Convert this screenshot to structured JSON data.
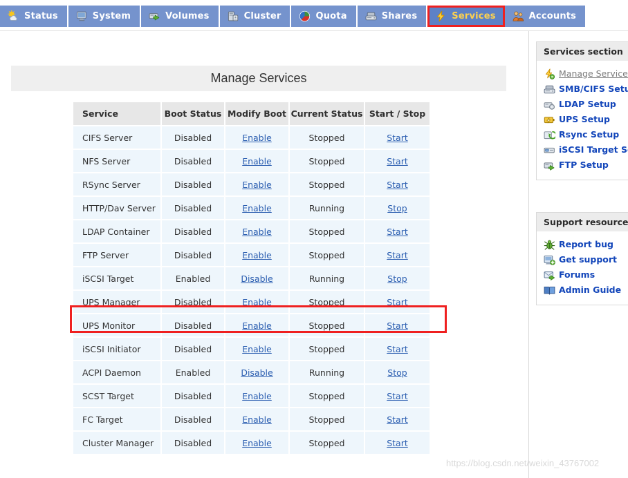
{
  "nav": {
    "tabs": [
      {
        "label": "Status",
        "icon": "sun-cloud-icon",
        "active": false
      },
      {
        "label": "System",
        "icon": "monitor-icon",
        "active": false
      },
      {
        "label": "Volumes",
        "icon": "disk-arrow-icon",
        "active": false
      },
      {
        "label": "Cluster",
        "icon": "servers-icon",
        "active": false
      },
      {
        "label": "Quota",
        "icon": "pie-chart-icon",
        "active": false
      },
      {
        "label": "Shares",
        "icon": "drive-icon",
        "active": false
      },
      {
        "label": "Services",
        "icon": "lightning-icon",
        "active": true
      },
      {
        "label": "Accounts",
        "icon": "people-icon",
        "active": false
      }
    ],
    "active_tab": "Services",
    "active_highlight_color": "#ef2020",
    "tab_bg": "#7593cd",
    "tab_active_bg": "#5d81c6",
    "tab_active_text_color": "#ffd24d"
  },
  "main": {
    "title": "Manage Services",
    "table": {
      "columns": [
        "Service",
        "Boot Status",
        "Modify Boot",
        "Current Status",
        "Start / Stop"
      ],
      "rows": [
        {
          "service": "CIFS Server",
          "boot_status": "Disabled",
          "modify_boot": "Enable",
          "current_status": "Stopped",
          "start_stop": "Start",
          "boot_on": false,
          "running": false,
          "highlighted": false
        },
        {
          "service": "NFS Server",
          "boot_status": "Disabled",
          "modify_boot": "Enable",
          "current_status": "Stopped",
          "start_stop": "Start",
          "boot_on": false,
          "running": false,
          "highlighted": false
        },
        {
          "service": "RSync Server",
          "boot_status": "Disabled",
          "modify_boot": "Enable",
          "current_status": "Stopped",
          "start_stop": "Start",
          "boot_on": false,
          "running": false,
          "highlighted": false
        },
        {
          "service": "HTTP/Dav Server",
          "boot_status": "Disabled",
          "modify_boot": "Enable",
          "current_status": "Running",
          "start_stop": "Stop",
          "boot_on": false,
          "running": true,
          "highlighted": false
        },
        {
          "service": "LDAP Container",
          "boot_status": "Disabled",
          "modify_boot": "Enable",
          "current_status": "Stopped",
          "start_stop": "Start",
          "boot_on": false,
          "running": false,
          "highlighted": false
        },
        {
          "service": "FTP Server",
          "boot_status": "Disabled",
          "modify_boot": "Enable",
          "current_status": "Stopped",
          "start_stop": "Start",
          "boot_on": false,
          "running": false,
          "highlighted": false
        },
        {
          "service": "iSCSI Target",
          "boot_status": "Enabled",
          "modify_boot": "Disable",
          "current_status": "Running",
          "start_stop": "Stop",
          "boot_on": true,
          "running": true,
          "highlighted": true
        },
        {
          "service": "UPS Manager",
          "boot_status": "Disabled",
          "modify_boot": "Enable",
          "current_status": "Stopped",
          "start_stop": "Start",
          "boot_on": false,
          "running": false,
          "highlighted": false
        },
        {
          "service": "UPS Monitor",
          "boot_status": "Disabled",
          "modify_boot": "Enable",
          "current_status": "Stopped",
          "start_stop": "Start",
          "boot_on": false,
          "running": false,
          "highlighted": false
        },
        {
          "service": "iSCSI Initiator",
          "boot_status": "Disabled",
          "modify_boot": "Enable",
          "current_status": "Stopped",
          "start_stop": "Start",
          "boot_on": false,
          "running": false,
          "highlighted": false
        },
        {
          "service": "ACPI Daemon",
          "boot_status": "Enabled",
          "modify_boot": "Disable",
          "current_status": "Running",
          "start_stop": "Stop",
          "boot_on": true,
          "running": true,
          "highlighted": false
        },
        {
          "service": "SCST Target",
          "boot_status": "Disabled",
          "modify_boot": "Enable",
          "current_status": "Stopped",
          "start_stop": "Start",
          "boot_on": false,
          "running": false,
          "highlighted": false
        },
        {
          "service": "FC Target",
          "boot_status": "Disabled",
          "modify_boot": "Enable",
          "current_status": "Stopped",
          "start_stop": "Start",
          "boot_on": false,
          "running": false,
          "highlighted": false
        },
        {
          "service": "Cluster Manager",
          "boot_status": "Disabled",
          "modify_boot": "Enable",
          "current_status": "Stopped",
          "start_stop": "Start",
          "boot_on": false,
          "running": false,
          "highlighted": false
        }
      ],
      "colors": {
        "disabled_bg": "#f8cb64",
        "enabled_bg": "#ddf0b8",
        "cell_bg": "#eef6fc",
        "header_bg": "#e7e7e7",
        "link": "#2a5db0"
      }
    }
  },
  "sidebar": {
    "services_section": {
      "heading": "Services section",
      "items": [
        {
          "label": "Manage Services",
          "icon": "lightning-gear-icon",
          "current": true
        },
        {
          "label": "SMB/CIFS Setup",
          "icon": "drive-icon",
          "current": false
        },
        {
          "label": "LDAP Setup",
          "icon": "gear-disk-icon",
          "current": false
        },
        {
          "label": "UPS Setup",
          "icon": "battery-bolt-icon",
          "current": false
        },
        {
          "label": "Rsync Setup",
          "icon": "sync-icon",
          "current": false
        },
        {
          "label": "iSCSI Target Setup",
          "icon": "target-disk-icon",
          "current": false
        },
        {
          "label": "FTP Setup",
          "icon": "ftp-icon",
          "current": false
        }
      ]
    },
    "support_section": {
      "heading": "Support resources",
      "items": [
        {
          "label": "Report bug",
          "icon": "bug-icon",
          "current": false
        },
        {
          "label": "Get support",
          "icon": "support-icon",
          "current": false
        },
        {
          "label": "Forums",
          "icon": "forums-icon",
          "current": false
        },
        {
          "label": "Admin Guide",
          "icon": "book-icon",
          "current": false
        }
      ]
    }
  },
  "watermark": {
    "text": "https://blog.csdn.net/weixin_43767002"
  }
}
